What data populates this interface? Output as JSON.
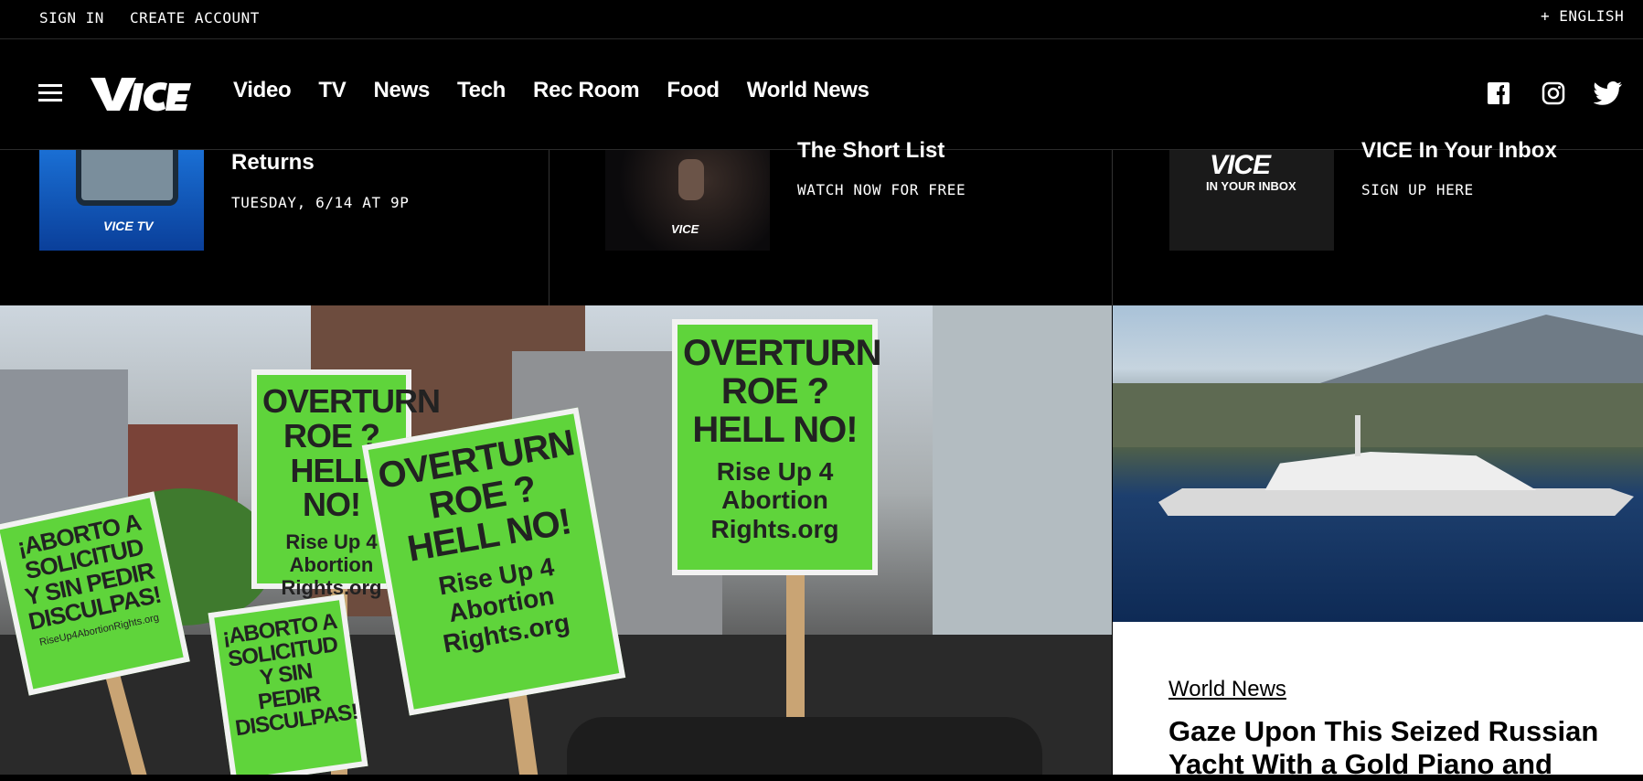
{
  "utility": {
    "sign_in": "SIGN IN",
    "create_account": "CREATE ACCOUNT",
    "language": "+ ENGLISH"
  },
  "nav": {
    "links": [
      "Video",
      "TV",
      "News",
      "Tech",
      "Rec Room",
      "Food",
      "World News"
    ],
    "social": [
      "facebook-icon",
      "instagram-icon",
      "twitter-icon"
    ]
  },
  "promos": [
    {
      "title": "Returns",
      "subtitle": "TUESDAY, 6/14 AT 9P",
      "thumb_text": "VICE TV"
    },
    {
      "title": "The Short List",
      "subtitle": "WATCH NOW FOR FREE",
      "thumb_text": "VICE"
    },
    {
      "title": "VICE In Your Inbox",
      "subtitle": "SIGN UP HERE",
      "thumb_text": "VICE",
      "thumb_sub": "IN YOUR INBOX"
    }
  ],
  "hero": {
    "signs": {
      "overturn_lines": [
        "OVERTURN",
        "ROE ?",
        "HELL NO!"
      ],
      "rise_lines": [
        "Rise Up 4",
        "Abortion",
        "Rights.org"
      ],
      "aborto_lines": [
        "¡ABORTO A",
        "SOLICITUD",
        "Y SIN PEDIR",
        "DISCULPAS!"
      ],
      "aborto_url": "RiseUp4AbortionRights.org"
    }
  },
  "article": {
    "category": "World News",
    "headline": "Gaze Upon This Seized Russian Yacht With a Gold Piano and"
  },
  "colors": {
    "background": "#000000",
    "sign_green": "#5fd43b",
    "article_bg": "#ffffff"
  }
}
